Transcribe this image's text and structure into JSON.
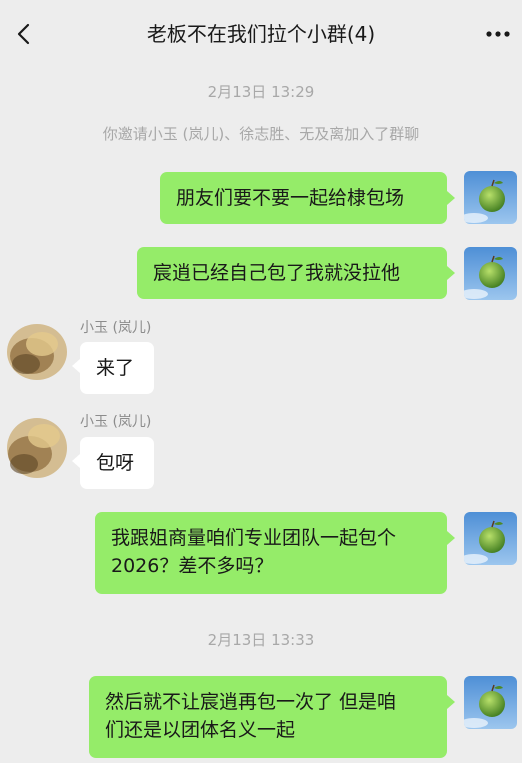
{
  "header": {
    "title": "老板不在我们拉个小群(4)",
    "back_icon": "chevron-left-icon",
    "more_icon": "more-dots-icon"
  },
  "messages": {
    "time1": "2月13日 13:29",
    "system": "你邀请小玉 (岚儿)、徐志胜、无及离加入了群聊",
    "m1": "朋友们要不要一起给棣包场",
    "m2": "宸逍已经自己包了我就没拉他",
    "sender3": "小玉 (岚儿)",
    "m3": "来了",
    "sender4": "小玉 (岚儿)",
    "m4": "包呀",
    "m5_line1": "我跟姐商量咱们专业团队一起包个",
    "m5_line2": "2026？差不多吗？",
    "time2": "2月13日 13:33",
    "m6_line1": "然后就不让宸逍再包一次了 但是咱",
    "m6_line2": "们还是以团体名义一起"
  },
  "colors": {
    "background": "#EDEDED",
    "my_bubble": "#95EC69",
    "other_bubble": "#FFFFFF",
    "timestamp": "#A8A8A8"
  }
}
